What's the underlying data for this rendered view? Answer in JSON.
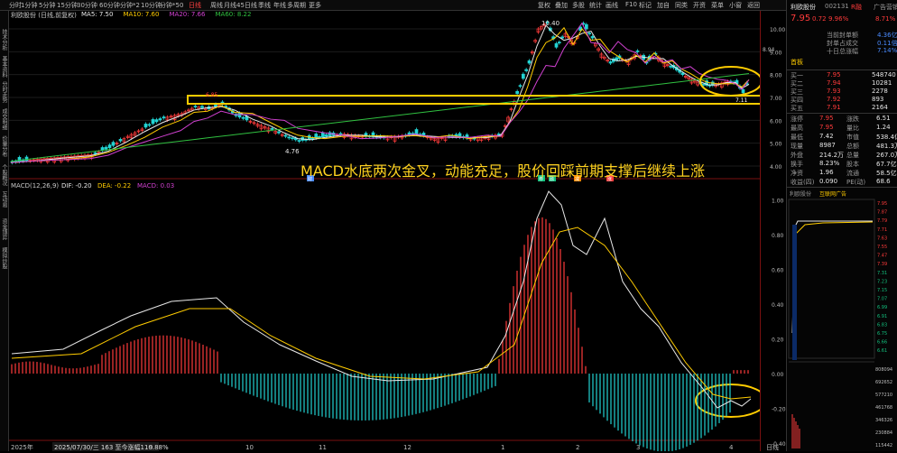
{
  "toolbar": {
    "items": [
      "分时",
      "1分钟",
      "5分钟",
      "15分钟",
      "30分钟",
      "60分钟",
      "分钟*2",
      "10分钟",
      "分钟*50",
      "日线",
      "周线",
      "月线",
      "45日线",
      "季线",
      "年线",
      "多周期",
      "更多"
    ],
    "active": "日线",
    "right_items": [
      "复权",
      "叠加",
      "多股",
      "统计",
      "画线",
      "F10",
      "标记",
      "自选",
      "返回"
    ],
    "misc": [
      "加自",
      "同类",
      "开资",
      "菜单",
      "小窗",
      "标记"
    ]
  },
  "left_rail": [
    "技术分析",
    "基本资料",
    "分时走势",
    "成交明细",
    "价量分布",
    "个股概况",
    "互动易",
    "资金博弈",
    "模拟炒股"
  ],
  "main_panel": {
    "title": "利欧股份 (日线,前复权)",
    "ma_legend": [
      {
        "label": "MA5: 7.50",
        "color": "#e8e8e8"
      },
      {
        "label": "MA10: 7.60",
        "color": "#ffcc00"
      },
      {
        "label": "MA20: 7.66",
        "color": "#d040d0"
      },
      {
        "label": "MA60: 8.22",
        "color": "#30c040"
      }
    ],
    "high_label": "10.40",
    "low_label": "4.76",
    "box_label": "6.85",
    "recent_low_label": "7.11",
    "right_label": "8.94",
    "y_ticks": [
      "10.00",
      "9.00",
      "8.00",
      "7.00",
      "6.00",
      "5.00",
      "4.00"
    ]
  },
  "annotation": "MACD水底两次金叉，动能充足，股价回踩前期支撑后继续上涨",
  "macd_panel": {
    "title": "MACD(12,26,9)",
    "dif": "DIF: -0.20",
    "dea": "DEA: -0.22",
    "macd": "MACD: 0.03",
    "y_ticks": [
      "1.00",
      "0.80",
      "0.60",
      "0.40",
      "0.20",
      "0.00",
      "-0.20",
      "-0.40"
    ]
  },
  "x_axis": {
    "year_label": "2025年",
    "cursor_info": "2025/07/30/三 163 至今涨幅110.88%",
    "months": [
      "9",
      "10",
      "11",
      "12",
      "1",
      "2",
      "3",
      "4"
    ],
    "period": "日线"
  },
  "events": [
    "财",
    "券",
    "融",
    "减",
    "涨"
  ],
  "quote": {
    "name": "利欧股份",
    "code": "002131",
    "badge": "R融",
    "price": "7.95",
    "change": "0.72",
    "pct": "9.96%",
    "side_tag": "广告营销",
    "side_pct": "8.71%",
    "board_info": [
      {
        "label": "当前封单额",
        "value": "4.36亿"
      },
      {
        "label": "封单占成交",
        "value": "0.11倍"
      },
      {
        "label": "十日总涨幅",
        "value": "7.14%"
      }
    ],
    "limit_tag": "首板",
    "sells": [
      {
        "label": "卖五",
        "price": "",
        "vol": ""
      },
      {
        "label": "卖四",
        "price": "",
        "vol": ""
      },
      {
        "label": "卖三",
        "price": "",
        "vol": ""
      },
      {
        "label": "卖二",
        "price": "",
        "vol": ""
      },
      {
        "label": "卖一",
        "price": "",
        "vol": ""
      }
    ],
    "buys": [
      {
        "label": "买一",
        "price": "7.95",
        "vol": "548740"
      },
      {
        "label": "买二",
        "price": "7.94",
        "vol": "10281"
      },
      {
        "label": "买三",
        "price": "7.93",
        "vol": "2278"
      },
      {
        "label": "买四",
        "price": "7.92",
        "vol": "893"
      },
      {
        "label": "买五",
        "price": "7.91",
        "vol": "2164"
      }
    ],
    "stats": [
      [
        "涨停",
        "7.95",
        "涨跌",
        "6.51"
      ],
      [
        "最高",
        "7.95",
        "量比",
        "1.24"
      ],
      [
        "最低",
        "7.42",
        "市值",
        "538.4亿"
      ],
      [
        "现量",
        "8987",
        "总额",
        "481.3万"
      ],
      [
        "外盘",
        "214.2万",
        "总量",
        "267.0万"
      ],
      [
        "换手",
        "8.23%",
        "股本",
        "67.7亿"
      ],
      [
        "净资",
        "1.96",
        "流通",
        "58.5亿"
      ],
      [
        "收益(四)",
        "0.090",
        "PE(动)",
        "68.6"
      ]
    ],
    "mini_tabs": [
      "利欧股份",
      "互联网广告"
    ],
    "mini_price_ticks": [
      "7.95",
      "7.87",
      "7.79",
      "7.71",
      "7.63",
      "7.55",
      "7.47",
      "7.39",
      "7.31",
      "7.23",
      "7.15",
      "7.07",
      "6.99",
      "6.91",
      "6.83",
      "6.75",
      "6.66",
      "6.61"
    ],
    "mini_vol_ticks": [
      "808094",
      "692652",
      "577210",
      "461768",
      "346326",
      "230884",
      "115442"
    ]
  },
  "colors": {
    "up": "#ff3b3b",
    "down": "#13c27f",
    "highlight": "#ffcc00"
  }
}
